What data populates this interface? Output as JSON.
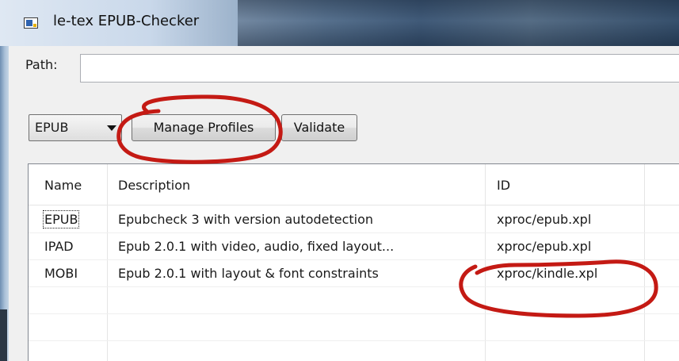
{
  "window": {
    "title": "le-tex EPUB-Checker",
    "icon": "app-window-icon"
  },
  "path": {
    "label": "Path:",
    "value": ""
  },
  "toolbar": {
    "profile_selected": "EPUB",
    "manage_label": "Manage Profiles",
    "validate_label": "Validate"
  },
  "table": {
    "headers": [
      "Name",
      "Description",
      "ID"
    ],
    "rows": [
      {
        "name": "EPUB",
        "description": "Epubcheck 3 with version autodetection",
        "id": "xproc/epub.xpl"
      },
      {
        "name": "IPAD",
        "description": "Epub 2.0.1 with video, audio, fixed layout...",
        "id": "xproc/epub.xpl"
      },
      {
        "name": "MOBI",
        "description": "Epub 2.0.1 with layout & font constraints",
        "id": "xproc/kindle.xpl"
      }
    ]
  },
  "colors": {
    "annotation": "#c41a14",
    "titlebar": "#4d6a8b"
  }
}
